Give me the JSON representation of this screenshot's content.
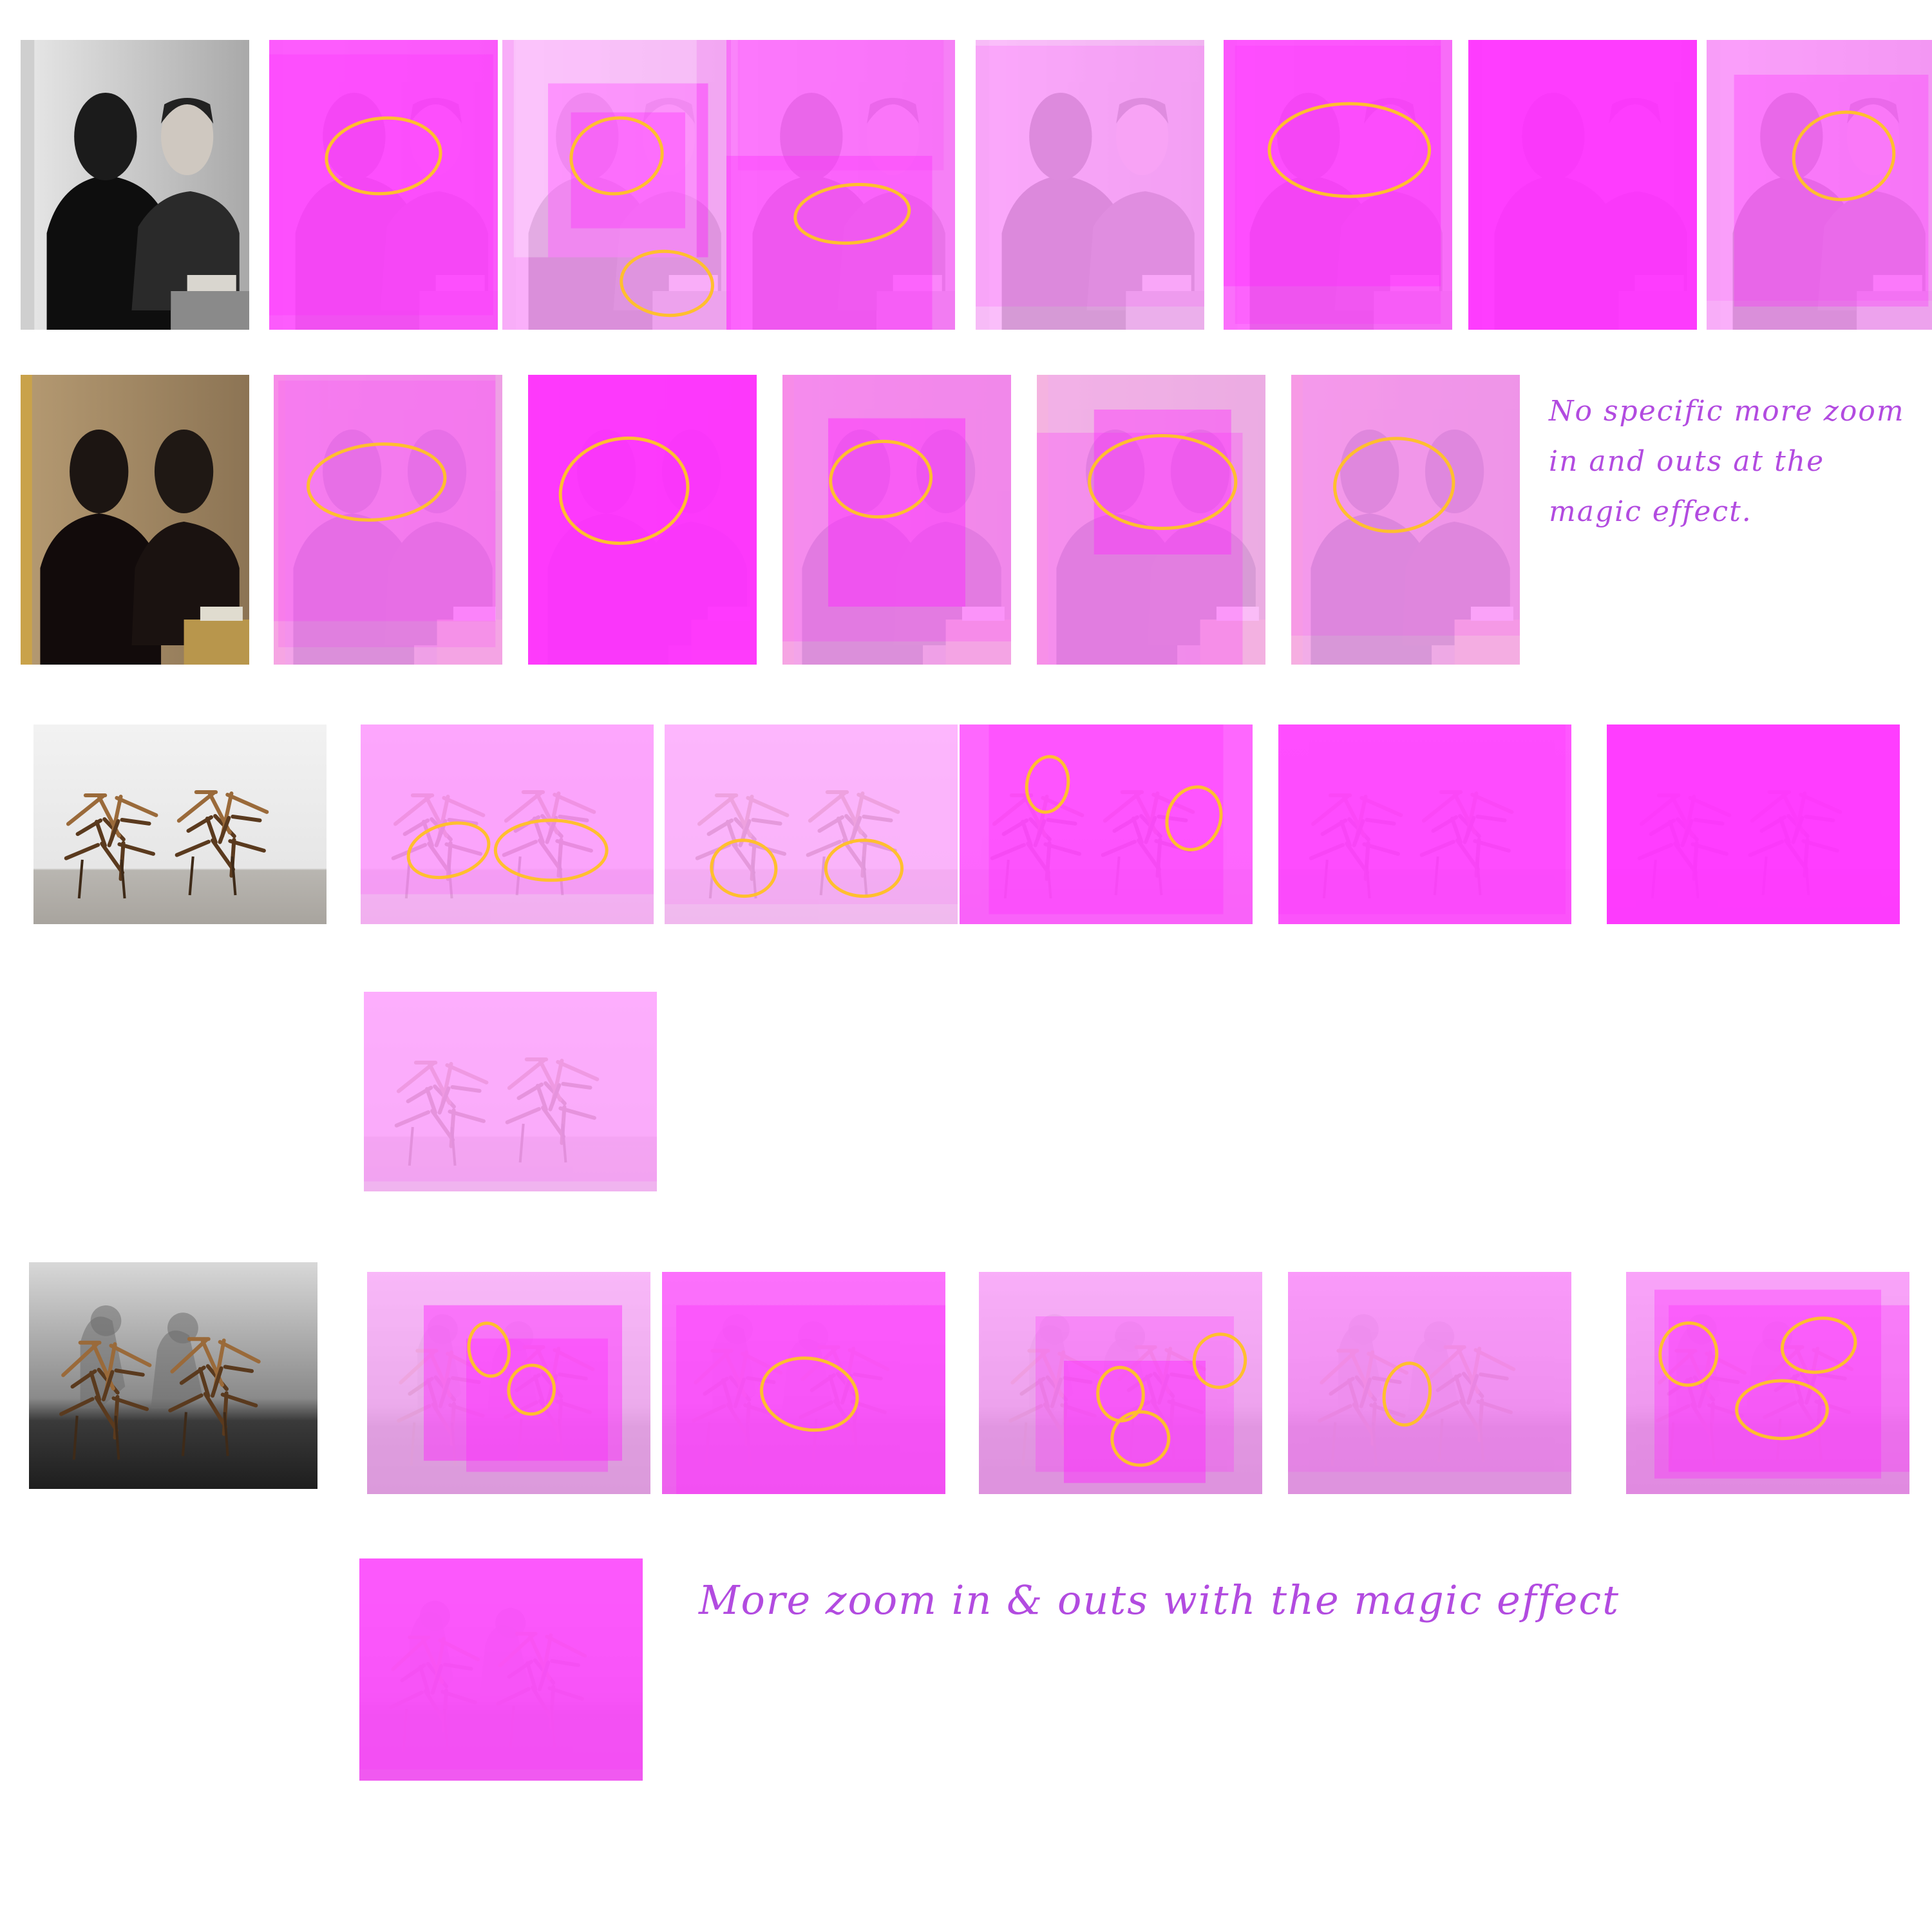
{
  "annotations": {
    "row2_note": "No specific more zoom in and outs at the magic effect.",
    "row5_note": "More zoom in & outs with the magic effect"
  },
  "colors": {
    "background": "#ffffff",
    "overlay_magenta": "#ff28ff",
    "circle_marker": "#ffbf2e",
    "note_text": "#b24be0"
  },
  "rows": [
    {
      "id": "row-1",
      "reference": "portrait-bw",
      "frames": 7
    },
    {
      "id": "row-2",
      "reference": "portrait-color",
      "frames": 5
    },
    {
      "id": "row-3",
      "reference": "sculpture",
      "frames": 6
    },
    {
      "id": "row-4",
      "reference": "sculpture-shadows",
      "frames": 6
    }
  ]
}
